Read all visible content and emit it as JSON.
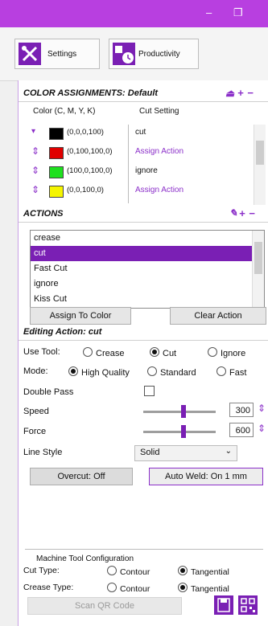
{
  "titlebar": {
    "minimize": "–",
    "maximize": "❐"
  },
  "toolbar": {
    "settings_label": "Settings",
    "productivity_label": "Productivity"
  },
  "color_assignments": {
    "header": "COLOR ASSIGNMENTS: Default",
    "col_color": "Color (C, M, Y, K)",
    "col_cut": "Cut Setting",
    "rows": [
      {
        "color": "#000000",
        "cmyk": "(0,0,0,100)",
        "setting": "cut",
        "purple": false
      },
      {
        "color": "#e00000",
        "cmyk": "(0,100,100,0)",
        "setting": "Assign Action",
        "purple": true
      },
      {
        "color": "#1fe01f",
        "cmyk": "(100,0,100,0)",
        "setting": "ignore",
        "purple": false
      },
      {
        "color": "#f5f500",
        "cmyk": "(0,0,100,0)",
        "setting": "Assign Action",
        "purple": true
      }
    ]
  },
  "actions": {
    "header": "ACTIONS",
    "items": [
      "crease",
      "cut",
      "Fast Cut",
      "ignore",
      "Kiss Cut"
    ],
    "selected_index": 1,
    "assign_button": "Assign To Color",
    "clear_button": "Clear Action"
  },
  "editing": {
    "header": "Editing Action: cut",
    "use_tool_label": "Use Tool:",
    "tools": [
      "Crease",
      "Cut",
      "Ignore"
    ],
    "tool_selected": "Cut",
    "mode_label": "Mode:",
    "modes": [
      "High Quality",
      "Standard",
      "Fast"
    ],
    "mode_selected": "High Quality",
    "double_pass_label": "Double Pass",
    "speed_label": "Speed",
    "speed_value": "300",
    "speed_fraction": 0.55,
    "force_label": "Force",
    "force_value": "600",
    "force_fraction": 0.55,
    "line_style_label": "Line Style",
    "line_style_value": "Solid",
    "overcut_button": "Overcut: Off",
    "autoweld_button": "Auto Weld: On 1 mm"
  },
  "machine": {
    "title": "Machine Tool Configuration",
    "cut_type_label": "Cut Type:",
    "crease_type_label": "Crease Type:",
    "contour": "Contour",
    "tangential": "Tangential",
    "cut_selected": "Tangential",
    "crease_selected": "Tangential"
  },
  "scan_button": "Scan QR Code"
}
